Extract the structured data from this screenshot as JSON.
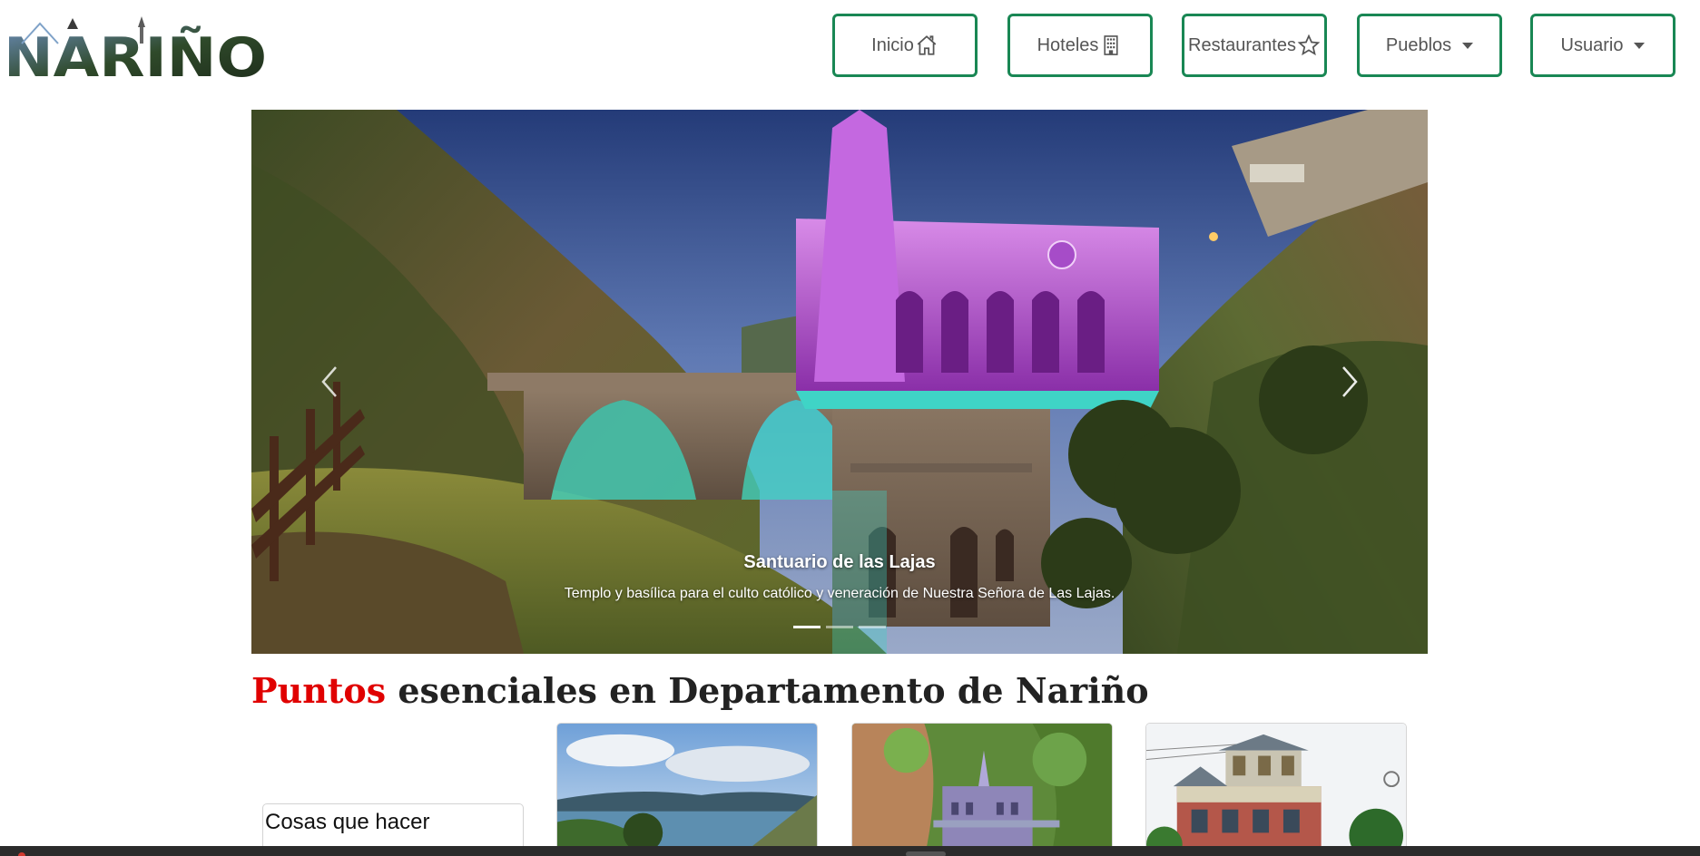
{
  "brand": {
    "logo_text": "NARIÑO"
  },
  "nav": {
    "items": [
      {
        "label": "Inicio",
        "icon": "home-icon"
      },
      {
        "label": "Hoteles",
        "icon": "building-icon"
      },
      {
        "label": "Restaurantes",
        "icon": "star-icon"
      },
      {
        "label": "Pueblos",
        "icon": "dropdown-caret"
      },
      {
        "label": "Usuario",
        "icon": "dropdown-caret"
      }
    ],
    "accent_color": "#198754"
  },
  "carousel": {
    "caption_title": "Santuario de las Lajas",
    "caption_text": "Templo y basílica para el culto católico y veneración de Nuestra Señora de Las Lajas.",
    "slide_count": 3,
    "active_slide": 1
  },
  "section": {
    "title_accent": "Puntos",
    "title_rest": " esenciales en Departamento de Nariño",
    "accent_color": "#e00000"
  },
  "cards": {
    "things_to_do": "Cosas que hacer"
  }
}
